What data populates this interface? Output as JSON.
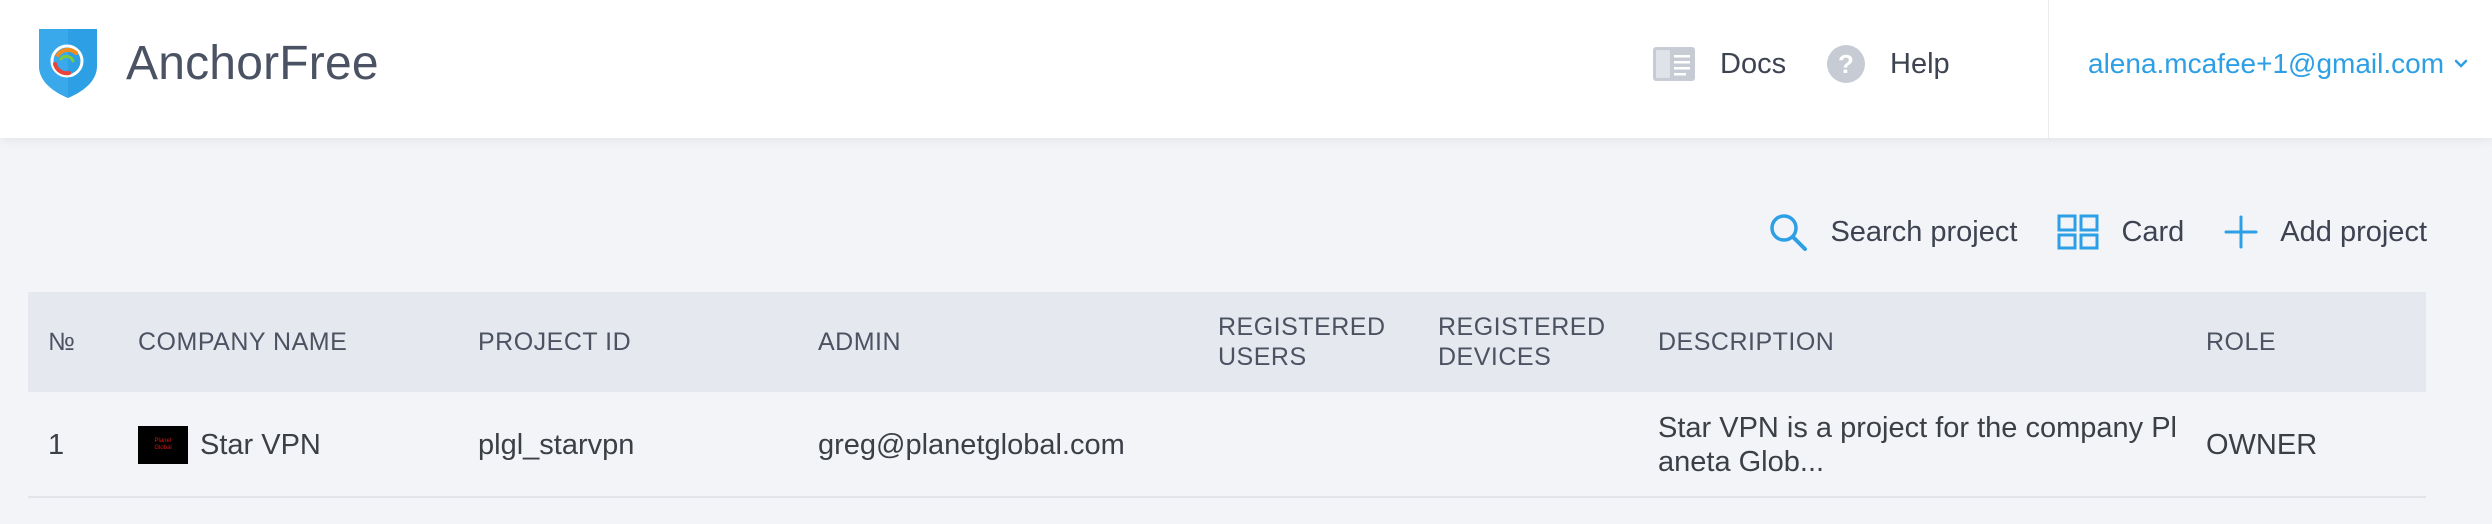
{
  "header": {
    "brand": "AnchorFree",
    "docs_label": "Docs",
    "help_label": "Help",
    "user_email": "alena.mcafee+1@gmail.com"
  },
  "toolbar": {
    "search_label": "Search project",
    "card_label": "Card",
    "add_label": "Add project"
  },
  "table": {
    "columns": {
      "num": "№",
      "company": "COMPANY NAME",
      "project_id": "PROJECT ID",
      "admin": "ADMIN",
      "users_1": "REGISTERED",
      "users_2": "USERS",
      "devices_1": "REGISTERED",
      "devices_2": "DEVICES",
      "description": "DESCRIPTION",
      "role": "ROLE"
    },
    "rows": [
      {
        "num": "1",
        "company": "Star VPN",
        "logo_text_1": "Planet",
        "logo_text_2": "Global",
        "project_id": "plgl_starvpn",
        "admin": "greg@planetglobal.com",
        "users": "",
        "devices": "",
        "description": "Star VPN is a project for the company Pl aneta Glob...",
        "role": "OWNER"
      }
    ]
  },
  "colors": {
    "accent": "#2d9fe5",
    "page_bg": "#f3f4f8",
    "header_bg": "#ffffff",
    "table_head_bg": "#e6e8ef"
  },
  "icons": {
    "logo": "anchorfree-shield-icon",
    "docs": "book-icon",
    "help": "question-circle-icon",
    "user_menu": "chevron-down-icon",
    "search": "search-icon",
    "card": "grid-icon",
    "add": "plus-icon"
  }
}
